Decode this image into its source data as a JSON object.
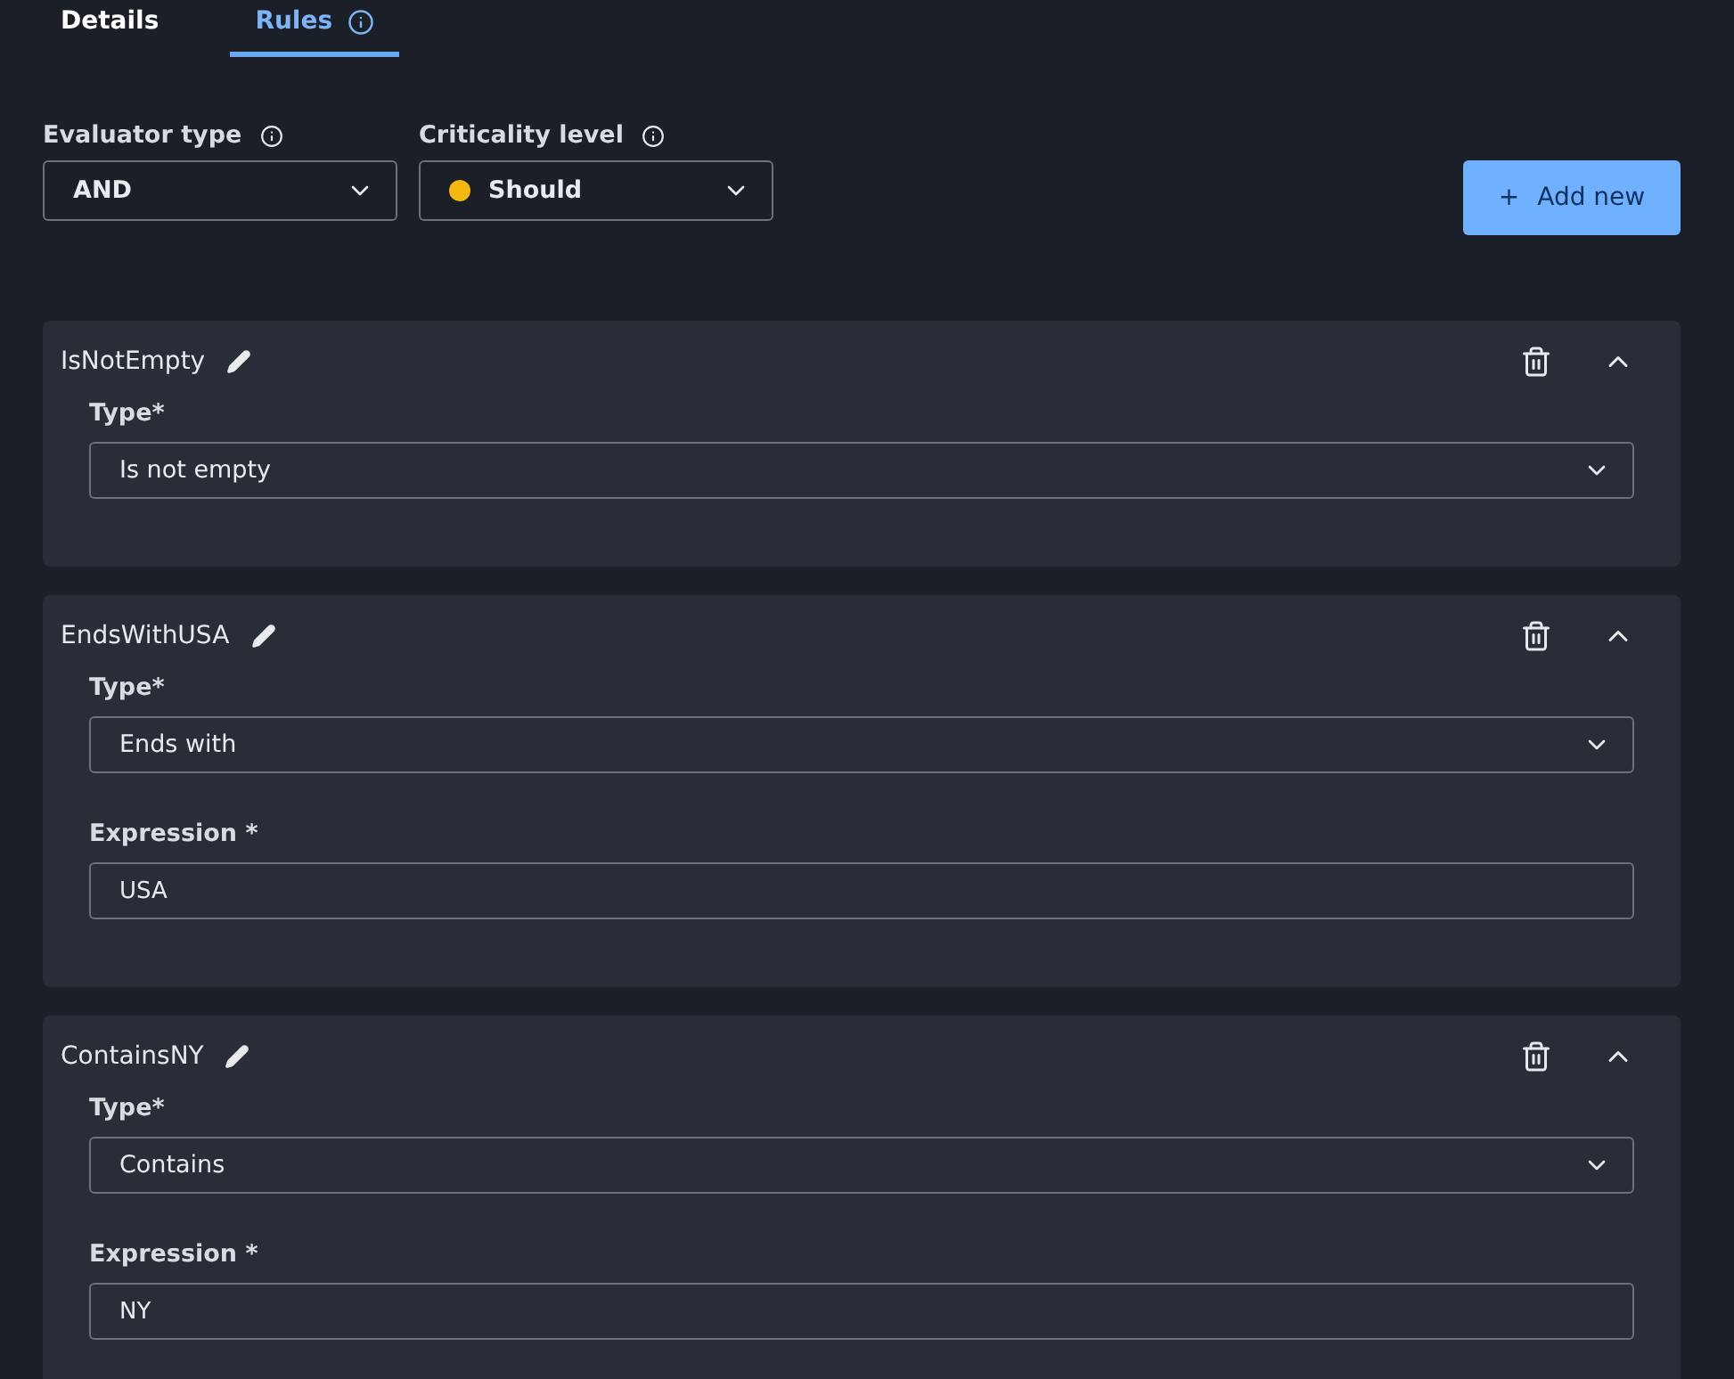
{
  "tabs": [
    {
      "label": "Details",
      "selected": false,
      "info": false
    },
    {
      "label": "Rules",
      "selected": true,
      "info": true
    }
  ],
  "filters": [
    {
      "label": "Evaluator type",
      "value": "AND"
    },
    {
      "label": "Criticality level",
      "value": "Should",
      "color": "#f5b80f"
    }
  ],
  "add_button": {
    "label": "Add new",
    "icon": "+"
  },
  "rules": [
    {
      "name": "IsNotEmpty",
      "expanded": true,
      "fields": [
        {
          "label": "Type*",
          "value": "Is not empty",
          "kind": "select"
        }
      ]
    },
    {
      "name": "EndsWithUSA",
      "expanded": true,
      "fields": [
        {
          "label": "Type*",
          "value": "Ends with",
          "kind": "select"
        },
        {
          "label": "Expression *",
          "value": "USA",
          "kind": "text"
        }
      ]
    },
    {
      "name": "ContainsNY",
      "expanded": true,
      "fields": [
        {
          "label": "Type*",
          "value": "Contains",
          "kind": "select"
        },
        {
          "label": "Expression *",
          "value": "NY",
          "kind": "text"
        }
      ]
    }
  ]
}
